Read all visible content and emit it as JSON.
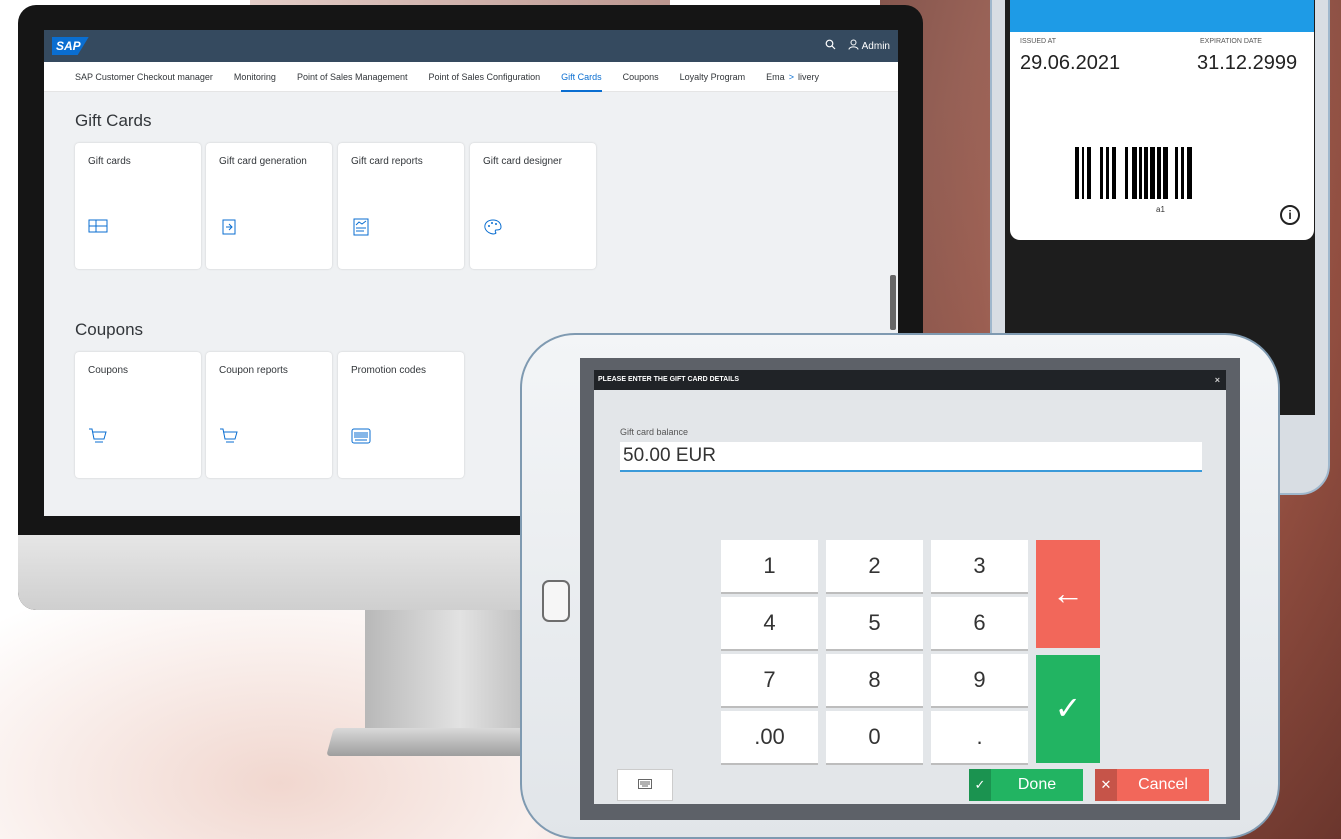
{
  "shell": {
    "logo": "SAP",
    "user_label": "Admin",
    "icons": [
      "search-icon",
      "user-icon"
    ]
  },
  "tabs": [
    {
      "label": "SAP Customer Checkout manager",
      "active": false
    },
    {
      "label": "Monitoring",
      "active": false
    },
    {
      "label": "Point of Sales Management",
      "active": false
    },
    {
      "label": "Point of Sales Configuration",
      "active": false
    },
    {
      "label": "Gift Cards",
      "active": true
    },
    {
      "label": "Coupons",
      "active": false
    },
    {
      "label": "Loyalty Program",
      "active": false
    }
  ],
  "tabs_overflow": {
    "left": "Ema",
    "right": "livery"
  },
  "gift_cards": {
    "title": "Gift Cards",
    "tiles": [
      {
        "label": "Gift cards",
        "icon": "gift-card-icon"
      },
      {
        "label": "Gift card generation",
        "icon": "generate-icon"
      },
      {
        "label": "Gift card reports",
        "icon": "report-icon"
      },
      {
        "label": "Gift card designer",
        "icon": "palette-icon"
      }
    ]
  },
  "coupons": {
    "title": "Coupons",
    "tiles": [
      {
        "label": "Coupons",
        "icon": "cart-icon"
      },
      {
        "label": "Coupon reports",
        "icon": "cart-icon"
      },
      {
        "label": "Promotion codes",
        "icon": "barcode-icon"
      }
    ]
  },
  "phone_card": {
    "issued_label": "ISSUED AT",
    "issued_value": "29.06.2021",
    "expiration_label": "EXPIRATION DATE",
    "expiration_value": "31.12.2999",
    "barcode_text": "a1",
    "accent_color": "#1e9be6"
  },
  "dialog": {
    "title": "PLEASE ENTER THE GIFT CARD DETAILS",
    "close": "×",
    "field_label": "Gift card balance",
    "field_value": "50.00 EUR",
    "keys": [
      "1",
      "2",
      "3",
      "4",
      "5",
      "6",
      "7",
      "8",
      "9",
      ".00",
      "0",
      "."
    ],
    "backspace": "←",
    "confirm": "✓",
    "done_label": "Done",
    "done_icon": "✓",
    "cancel_label": "Cancel",
    "cancel_icon": "✕",
    "keyboard_icon": "keyboard-icon",
    "colors": {
      "done": "#22b462",
      "cancel": "#f2675a"
    }
  }
}
